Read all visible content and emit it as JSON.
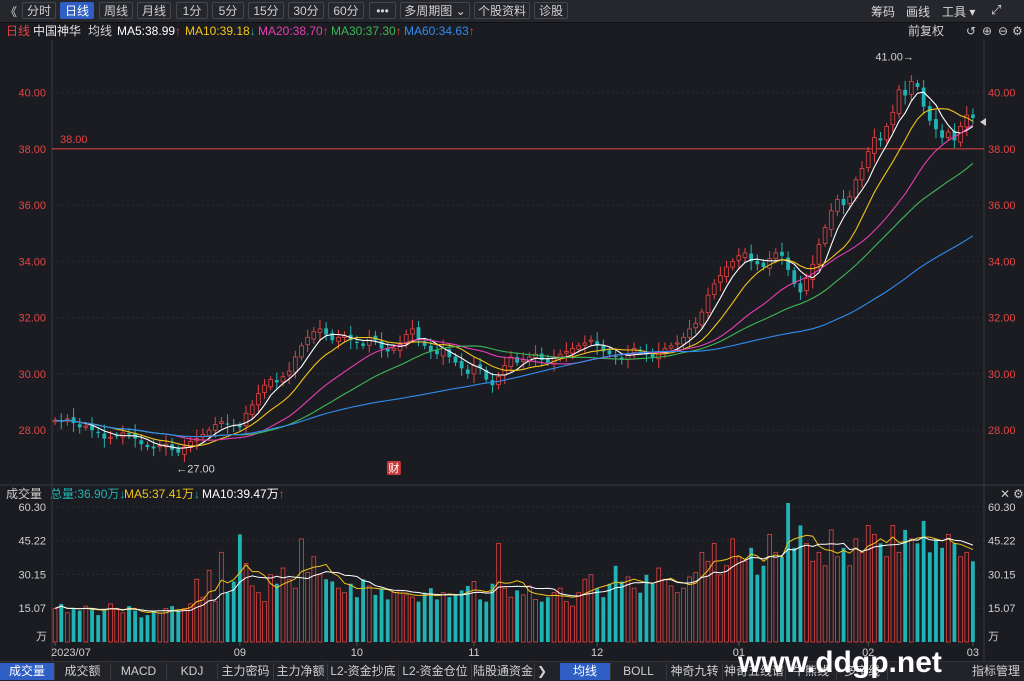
{
  "toolbar": {
    "back_glyph": "《",
    "buttons": [
      "分时",
      "日线",
      "周线",
      "月线",
      "1分",
      "5分",
      "15分",
      "30分",
      "60分",
      "•••",
      "多周期图 ⌄",
      "个股资料",
      "诊股"
    ],
    "active_index": 1,
    "right": [
      "筹码",
      "画线",
      "工具 ▾"
    ]
  },
  "ma_line": {
    "period": "日线",
    "stock_name": "中国神华",
    "avg_label": "均线",
    "ma5": "MA5:38.99",
    "ma10": "MA10:39.18",
    "ma20": "MA20:38.70",
    "ma30": "MA30:37.30",
    "ma60": "MA60:34.63",
    "restore": "前复权"
  },
  "vol_line": {
    "title": "成交量",
    "total": "总量:36.90万",
    "ma5": "MA5:37.41万",
    "ma10": "MA10:39.47万"
  },
  "colors": {
    "up": "#e64343",
    "down": "#21b3b3",
    "ma5": "#ffffff",
    "ma10": "#f2c319",
    "ma20": "#e63fb1",
    "ma30": "#3db856",
    "ma60": "#2f8cf0",
    "price_label": "#e64343"
  },
  "annotations": {
    "high_label": "41.00→",
    "low_label": "←27.00",
    "ref_line_label": "38.00",
    "finance_marker": "财"
  },
  "bottom_tabs": {
    "left": [
      "成交量",
      "成交额",
      "MACD",
      "KDJ",
      "主力密码",
      "主力净额",
      "L2-资金抄底",
      "L2-资金仓位",
      "陆股通资金"
    ],
    "left_active": 0,
    "right": [
      "均线",
      "BOLL",
      "神奇九转",
      "神奇五线谱",
      "牛熊线",
      "多空线"
    ],
    "right_active": 0,
    "manage": "指标管理",
    "watermark": "www.ddgp.net"
  },
  "chart_data": [
    {
      "type": "candlestick",
      "title": "中国神华 日线",
      "y_ticks": [
        "40.00",
        "38.00",
        "36.00",
        "34.00",
        "32.00",
        "30.00",
        "28.00"
      ],
      "y_range": [
        26.3,
        41.8
      ],
      "x_labels": [
        "2023/07",
        "09",
        "10",
        "11",
        "12",
        "01",
        "02",
        "03"
      ],
      "x_label_index": [
        0,
        30,
        49,
        68,
        88,
        111,
        132,
        149
      ],
      "ref_price": 38.0,
      "high": 41.0,
      "low": 27.0,
      "close_series": [
        28.35,
        28.3,
        28.4,
        28.25,
        28.1,
        28.15,
        28.0,
        27.9,
        27.7,
        27.75,
        27.8,
        27.9,
        27.85,
        27.7,
        27.5,
        27.4,
        27.35,
        27.45,
        27.5,
        27.3,
        27.2,
        27.4,
        27.6,
        27.7,
        27.85,
        28.0,
        28.2,
        28.3,
        28.2,
        28.15,
        28.1,
        28.6,
        28.9,
        29.3,
        29.6,
        29.8,
        29.7,
        29.9,
        30.1,
        30.6,
        31.0,
        31.3,
        31.5,
        31.6,
        31.4,
        31.2,
        31.3,
        31.35,
        31.2,
        31.1,
        31.0,
        31.3,
        31.2,
        30.9,
        30.8,
        30.9,
        31.1,
        31.4,
        31.6,
        31.2,
        31.0,
        30.8,
        30.7,
        30.9,
        30.6,
        30.4,
        30.2,
        30.0,
        30.3,
        30.2,
        29.8,
        29.6,
        29.9,
        30.3,
        30.6,
        30.4,
        30.5,
        30.6,
        30.7,
        30.5,
        30.4,
        30.6,
        30.7,
        30.8,
        30.9,
        31.0,
        31.1,
        31.2,
        31.0,
        30.8,
        30.7,
        30.6,
        30.5,
        30.7,
        30.9,
        30.8,
        30.7,
        30.6,
        30.8,
        30.9,
        31.0,
        31.1,
        31.3,
        31.6,
        31.8,
        32.2,
        32.8,
        33.2,
        33.5,
        33.8,
        34.0,
        34.2,
        34.3,
        34.0,
        33.9,
        33.8,
        34.1,
        34.3,
        34.2,
        33.7,
        33.2,
        32.9,
        33.4,
        33.9,
        34.6,
        35.2,
        35.8,
        36.2,
        36.0,
        36.3,
        36.9,
        37.3,
        37.9,
        38.4,
        38.3,
        38.8,
        39.3,
        40.1,
        39.9,
        40.4,
        40.2,
        39.5,
        39.0,
        38.7,
        38.4,
        38.6,
        38.3,
        38.8,
        39.2,
        39.1
      ]
    },
    {
      "type": "bar",
      "title": "成交量",
      "y_ticks": [
        "60.30",
        "45.22",
        "30.15",
        "15.07"
      ],
      "y_unit": "万",
      "y_range": [
        0,
        62
      ],
      "values": [
        15,
        17,
        13,
        15,
        14,
        16,
        15,
        12,
        14,
        17,
        15,
        13,
        16,
        14,
        11,
        12,
        14,
        13,
        15,
        16,
        14,
        15,
        17,
        28,
        20,
        32,
        18,
        40,
        22,
        27,
        48,
        35,
        25,
        22,
        18,
        30,
        26,
        33,
        28,
        24,
        46,
        31,
        38,
        30,
        28,
        27,
        24,
        22,
        26,
        20,
        28,
        25,
        21,
        24,
        19,
        22,
        23,
        21,
        20,
        18,
        22,
        24,
        19,
        22,
        20,
        21,
        23,
        25,
        27,
        19,
        18,
        26,
        44,
        24,
        20,
        23,
        21,
        25,
        19,
        18,
        20,
        22,
        24,
        18,
        16,
        22,
        28,
        30,
        24,
        20,
        26,
        34,
        27,
        29,
        24,
        22,
        30,
        26,
        33,
        28,
        25,
        22,
        24,
        29,
        31,
        40,
        36,
        44,
        30,
        34,
        46,
        38,
        36,
        42,
        30,
        34,
        48,
        40,
        38,
        62,
        42,
        52,
        44,
        36,
        40,
        34,
        50,
        38,
        42,
        34,
        46,
        40,
        52,
        48,
        44,
        38,
        52,
        40,
        50,
        46,
        44,
        54,
        40,
        46,
        42,
        48,
        44,
        38,
        40,
        36
      ]
    }
  ]
}
